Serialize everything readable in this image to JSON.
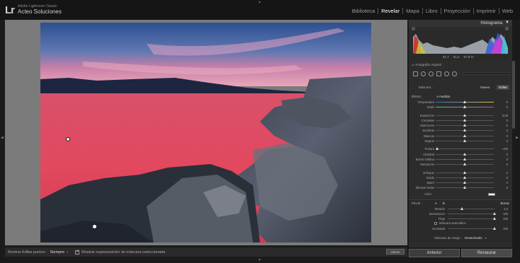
{
  "app": {
    "logo": "Lr",
    "product": "Adobe Lightroom Classic",
    "user": "Acteo Soluciones"
  },
  "modules": [
    "Biblioteca",
    "Revelar",
    "Mapa",
    "Libro",
    "Proyección",
    "Imprimir",
    "Web"
  ],
  "active_module": "Revelar",
  "toolbar": {
    "show_pins_label": "Mostrar Editar puntos :",
    "show_pins_value": "Siempre",
    "overlay_label": "Mostrar superposición de máscara seleccionada",
    "done_label": "Hecho"
  },
  "histogram": {
    "title": "Histograma",
    "values": [
      "61,7",
      "61,5",
      "67,8 %"
    ],
    "original_photo": "Fotografía original"
  },
  "mask": {
    "label": "Máscara :",
    "new": "Nuevo",
    "edit": "Editar",
    "effect_label": "Efecto :",
    "effect_value": "A medida"
  },
  "sliders_group1": [
    {
      "label": "Temperatura",
      "value": "0",
      "pos": 0.5,
      "grad": "temp"
    },
    {
      "label": "Matiz",
      "value": "0",
      "pos": 0.5,
      "grad": "tint"
    }
  ],
  "sliders_group2": [
    {
      "label": "Exposición",
      "value": "0,00",
      "pos": 0.5
    },
    {
      "label": "Contraste",
      "value": "0",
      "pos": 0.5
    },
    {
      "label": "Altas luces",
      "value": "0",
      "pos": 0.5
    },
    {
      "label": "Sombras",
      "value": "0",
      "pos": 0.5
    },
    {
      "label": "Blancos",
      "value": "0",
      "pos": 0.5
    },
    {
      "label": "Negros",
      "value": "0",
      "pos": 0.5
    }
  ],
  "sliders_group3": [
    {
      "label": "Textura",
      "value": "−100",
      "pos": 0.02
    },
    {
      "label": "Claridad",
      "value": "0",
      "pos": 0.5
    },
    {
      "label": "Borrar neblina",
      "value": "0",
      "pos": 0.5
    },
    {
      "label": "Saturación",
      "value": "0",
      "pos": 0.5
    }
  ],
  "sliders_group4": [
    {
      "label": "Enfoque",
      "value": "0",
      "pos": 0.5
    },
    {
      "label": "Ruido",
      "value": "0",
      "pos": 0.5
    },
    {
      "label": "Moiré",
      "value": "0",
      "pos": 0.5
    },
    {
      "label": "Eliminar halos",
      "value": "0",
      "pos": 0.5
    }
  ],
  "color_label": "Color",
  "brush": {
    "label": "Pincel :",
    "a": "A",
    "b": "B",
    "erase": "Borrar",
    "rows": [
      {
        "label": "Tamaño",
        "value": "4,0",
        "pos": 0.3
      },
      {
        "label": "Desvanecer",
        "value": "100",
        "pos": 1.0
      },
      {
        "label": "Flujo",
        "value": "100",
        "pos": 1.0
      }
    ],
    "auto_mask": "Máscara automática",
    "density_label": "Densidad",
    "density_value": "100",
    "density_pos": 1.0
  },
  "range_mask": {
    "label": "Máscara de rango :",
    "value": "Desactivado"
  },
  "buttons": {
    "previous": "Anterior",
    "reset": "Restaurar"
  }
}
